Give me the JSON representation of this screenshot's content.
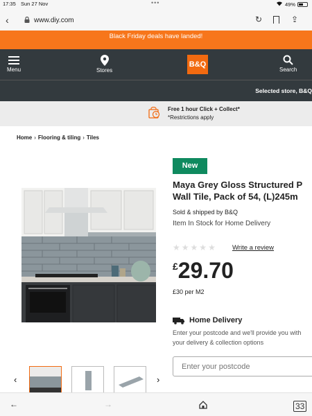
{
  "status_bar": {
    "time": "17:35",
    "date": "Sun 27 Nov",
    "battery": "49%"
  },
  "browser": {
    "url": "www.diy.com",
    "tab_count": "33"
  },
  "promo": {
    "text": "Black Friday deals have landed!"
  },
  "header": {
    "menu_label": "Menu",
    "stores_label": "Stores",
    "logo": "B&Q",
    "search_label": "Search"
  },
  "store_bar": {
    "text": "Selected store, B&Q"
  },
  "click_collect": {
    "title": "Free 1 hour Click + Collect*",
    "note": "*Restrictions apply"
  },
  "breadcrumb": {
    "items": [
      "Home",
      "Flooring & tiling",
      "Tiles"
    ]
  },
  "product": {
    "badge": "New",
    "title_line1": "Maya Grey Gloss Structured P",
    "title_line2": "Wall Tile, Pack of 54, (L)245m",
    "sold_by": "Sold & shipped by B&Q",
    "stock": "Item In Stock for Home Delivery",
    "rating": 0,
    "review_link": "Write a review",
    "price_currency": "£",
    "price": "29.70",
    "per_m2": "£30 per M2"
  },
  "delivery": {
    "title": "Home Delivery",
    "text": "Enter your postcode and we'll provide you with your delivery & collection options",
    "postcode_placeholder": "Enter your postcode"
  },
  "colors": {
    "orange": "#f26a10",
    "header_bg": "#333a3e",
    "badge_green": "#0f8a5f"
  }
}
